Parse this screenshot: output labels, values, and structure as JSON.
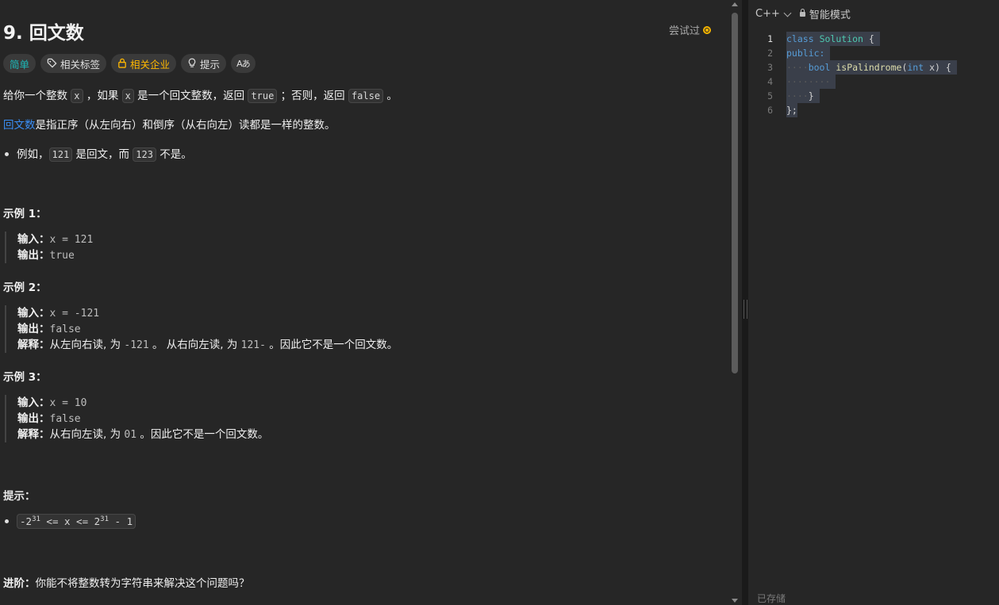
{
  "problem": {
    "title": "9. 回文数",
    "tried_label": "尝试过",
    "tags": {
      "difficulty": "简单",
      "related_tags": "相关标签",
      "related_companies": "相关企业",
      "hints": "提示",
      "translate": "Aあ"
    },
    "desc1": {
      "p1": "给你一个整数 ",
      "c1": "x",
      "p2": " ，如果 ",
      "c2": "x",
      "p3": " 是一个回文整数，返回 ",
      "c3": "true",
      "p4": " ；否则，返回 ",
      "c4": "false",
      "p5": " 。"
    },
    "desc2": {
      "link": "回文数",
      "rest": "是指正序（从左向右）和倒序（从右向左）读都是一样的整数。"
    },
    "desc3": {
      "p1": "例如，",
      "c1": "121",
      "p2": " 是回文，而 ",
      "c2": "123",
      "p3": " 不是。"
    },
    "examples": [
      {
        "title": "示例 1：",
        "input_label": "输入：",
        "input": "x = 121",
        "output_label": "输出：",
        "output": "true"
      },
      {
        "title": "示例 2：",
        "input_label": "输入：",
        "input": "x = -121",
        "output_label": "输出：",
        "output": "false",
        "explain_label": "解释：",
        "explain_1": "从左向右读, 为 ",
        "explain_code_1": "-121",
        "explain_2": " 。 从右向左读, 为 ",
        "explain_code_2": "121-",
        "explain_3": " 。因此它不是一个回文数。"
      },
      {
        "title": "示例 3：",
        "input_label": "输入：",
        "input": "x = 10",
        "output_label": "输出：",
        "output": "false",
        "explain_label": "解释：",
        "explain_1": "从右向左读, 为 ",
        "explain_code_1": "01",
        "explain_2": " 。因此它不是一个回文数。"
      }
    ],
    "hints_title": "提示：",
    "constraint": {
      "a": "-2",
      "a_sup": "31",
      "b": " <= x <= 2",
      "b_sup": "31",
      "c": " - 1"
    },
    "followup_label": "进阶：",
    "followup": "你能不将整数转为字符串来解决这个问题吗？"
  },
  "editor": {
    "language": "C++",
    "mode": "智能模式",
    "line_numbers": [
      "1",
      "2",
      "3",
      "4",
      "5",
      "6"
    ],
    "code": {
      "l1_kw": "class",
      "l1_cls": "Solution",
      "l1_rest": " {",
      "l2_kw": "public:",
      "l3_type": "bool",
      "l3_fn": "isPalindrome",
      "l3_open": "(",
      "l3_kw": "int",
      "l3_arg": " x) {",
      "l5_rest": "}",
      "l6_rest": "};"
    },
    "status": "已存储"
  },
  "colors": {
    "accent_easy": "#1cb8b8",
    "accent_company": "#ffb800",
    "link": "#3a8ef5",
    "tried": "#f5b400"
  }
}
